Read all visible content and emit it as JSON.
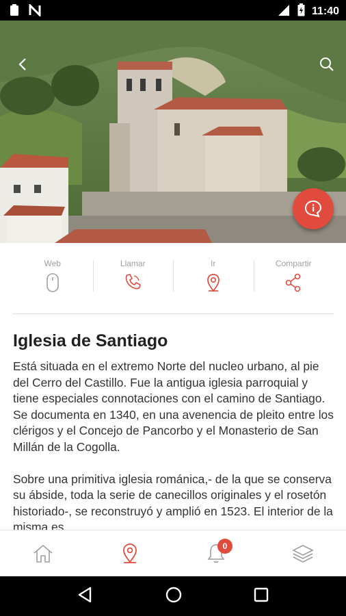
{
  "status_bar": {
    "time": "11:40"
  },
  "hero": {
    "image_alt": "Iglesia de Santiago"
  },
  "actions": [
    {
      "label": "Web",
      "icon": "mouse-icon"
    },
    {
      "label": "Llamar",
      "icon": "phone-icon"
    },
    {
      "label": "Ir",
      "icon": "location-pin-icon"
    },
    {
      "label": "Compartir",
      "icon": "share-icon"
    }
  ],
  "article": {
    "title": "Iglesia de Santiago",
    "paragraphs": [
      "Está situada en el extremo Norte del nucleo urbano, al pie del Cerro del Castillo. Fue la antigua iglesia parroquial y tiene especiales connotaciones con el camino de Santiago. Se documenta en 1340, en una avenencia de pleito entre los clérigos y el Concejo de Pancorbo y el Monasterio de San Millán de la Cogolla.",
      "Sobre una primitiva iglesia románica,- de la que se conserva su ábside, toda la serie de canecillos originales y el rosetón historiado-, se reconstruyó y amplió en 1523. El interior de la misma es"
    ]
  },
  "bottom_nav": {
    "items": [
      "home-icon",
      "location-pin-icon",
      "bell-icon",
      "layers-icon"
    ],
    "notification_count": "0"
  },
  "colors": {
    "accent": "#e14b3d",
    "muted": "#9e9e9e"
  }
}
